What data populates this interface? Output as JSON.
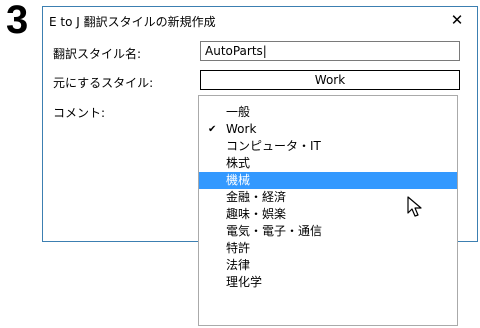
{
  "step_number": "3",
  "dialog": {
    "title": "E to J 翻訳スタイルの新規作成",
    "close_glyph": "✕",
    "style_name_label": "翻訳スタイル名:",
    "style_name_value": "AutoParts|",
    "base_style_label": "元にするスタイル:",
    "base_style_value": "Work",
    "comment_label": "コメント:"
  },
  "dropdown": {
    "items": [
      {
        "label": "一般",
        "checked": false,
        "highlighted": false
      },
      {
        "label": "Work",
        "checked": true,
        "highlighted": false
      },
      {
        "label": "コンピュータ・IT",
        "checked": false,
        "highlighted": false
      },
      {
        "label": "株式",
        "checked": false,
        "highlighted": false
      },
      {
        "label": "機械",
        "checked": false,
        "highlighted": true
      },
      {
        "label": "金融・経済",
        "checked": false,
        "highlighted": false
      },
      {
        "label": "趣味・娯楽",
        "checked": false,
        "highlighted": false
      },
      {
        "label": "電気・電子・通信",
        "checked": false,
        "highlighted": false
      },
      {
        "label": "特許",
        "checked": false,
        "highlighted": false
      },
      {
        "label": "法律",
        "checked": false,
        "highlighted": false
      },
      {
        "label": "理化学",
        "checked": false,
        "highlighted": false
      }
    ],
    "check_glyph": "✔"
  },
  "colors": {
    "highlight": "#3399ff",
    "dialog_border": "#3c7fb1"
  }
}
